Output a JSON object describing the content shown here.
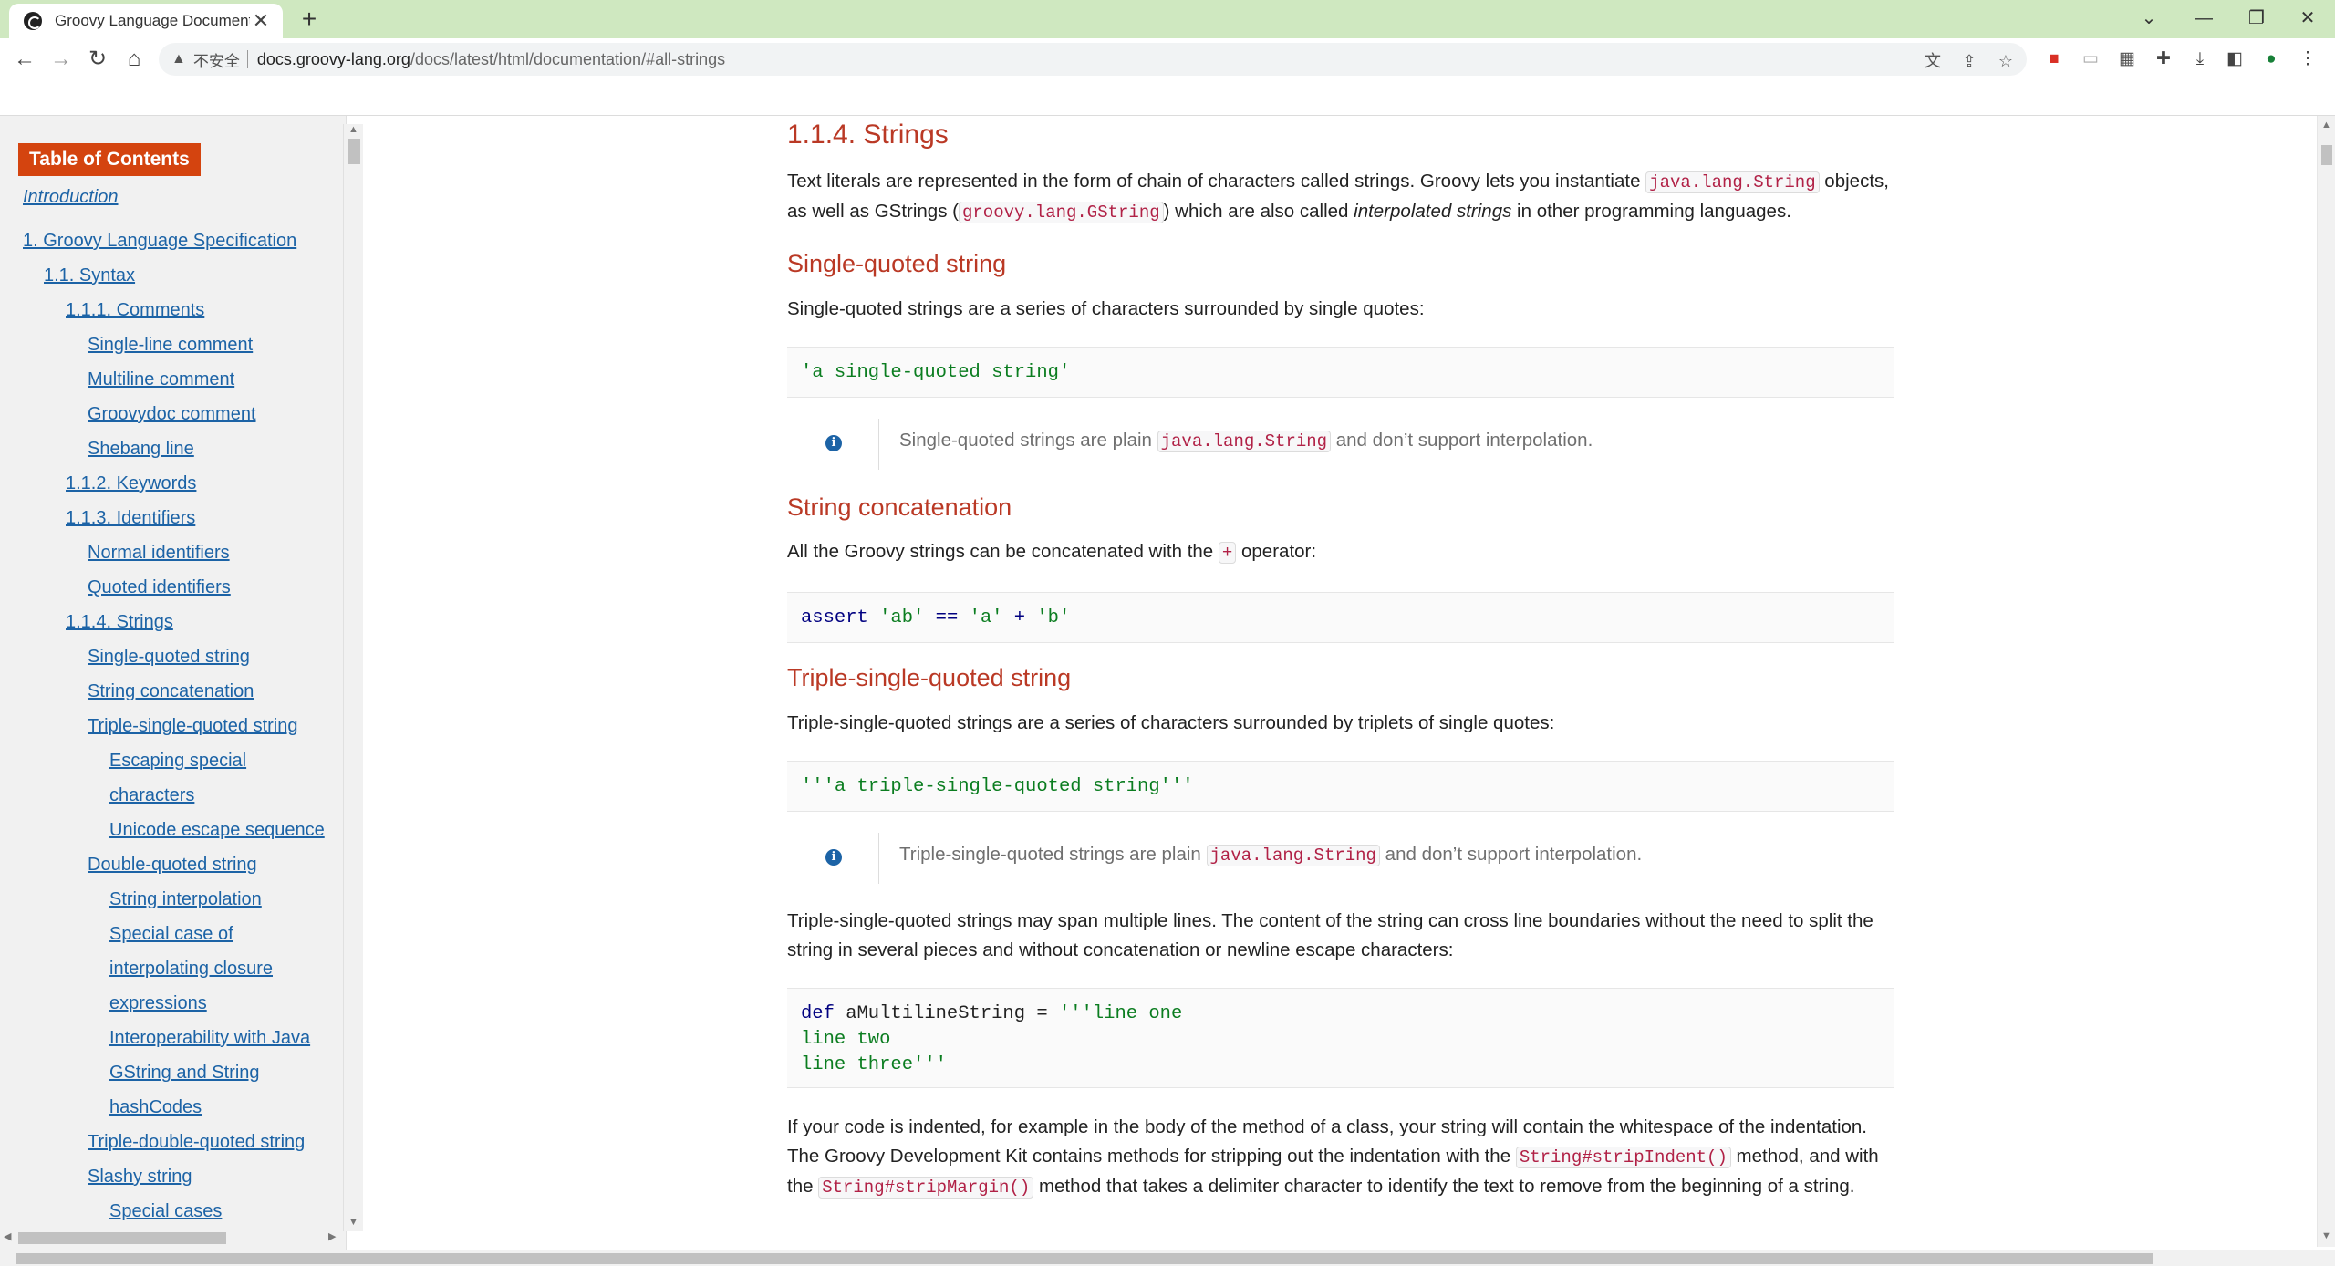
{
  "browser": {
    "tab_title": "Groovy Language Documentation",
    "new_tab": "+",
    "security_label": "不安全",
    "url_host": "docs.groovy-lang.org",
    "url_path": "/docs/latest/html/documentation/#all-strings",
    "window_controls": {
      "minimize": "—",
      "restore": "❐",
      "close": "✕",
      "tablist": "⌄"
    },
    "nav": {
      "back": "←",
      "forward": "→",
      "reload": "↻",
      "home": "⌂"
    }
  },
  "toc": {
    "title": "Table of Contents",
    "items": [
      {
        "label": "Introduction",
        "italic": true
      },
      {
        "label": "1. Groovy Language Specification"
      },
      {
        "label": "1.1. Syntax"
      },
      {
        "label": "1.1.1. Comments"
      },
      {
        "label": "Single-line comment"
      },
      {
        "label": "Multiline comment"
      },
      {
        "label": "Groovydoc comment"
      },
      {
        "label": "Shebang line"
      },
      {
        "label": "1.1.2. Keywords"
      },
      {
        "label": "1.1.3. Identifiers"
      },
      {
        "label": "Normal identifiers"
      },
      {
        "label": "Quoted identifiers"
      },
      {
        "label": "1.1.4. Strings"
      },
      {
        "label": "Single-quoted string"
      },
      {
        "label": "String concatenation"
      },
      {
        "label": "Triple-single-quoted string"
      },
      {
        "label": "Escaping special"
      },
      {
        "label": "characters"
      },
      {
        "label": "Unicode escape sequence"
      },
      {
        "label": "Double-quoted string"
      },
      {
        "label": "String interpolation"
      },
      {
        "label": "Special case of"
      },
      {
        "label": "interpolating closure"
      },
      {
        "label": "expressions"
      },
      {
        "label": "Interoperability with Java"
      },
      {
        "label": "GString and String"
      },
      {
        "label": "hashCodes"
      },
      {
        "label": "Triple-double-quoted string"
      },
      {
        "label": "Slashy string"
      },
      {
        "label": "Special cases"
      }
    ]
  },
  "content": {
    "section_title": "1.1.4. Strings",
    "intro": {
      "t1": "Text literals are represented in the form of chain of characters called strings. Groovy lets you instantiate ",
      "c1": "java.lang.String",
      "t2": " objects, as well as GStrings (",
      "c2": "groovy.lang.GString",
      "t3": ") which are also called ",
      "em": "interpolated strings",
      "t4": " in other programming languages."
    },
    "single": {
      "title": "Single-quoted string",
      "desc": "Single-quoted strings are a series of characters surrounded by single quotes:",
      "code": "'a single-quoted string'",
      "note_t1": "Single-quoted strings are plain ",
      "note_code": "java.lang.String",
      "note_t2": " and don’t support interpolation."
    },
    "concat": {
      "title": "String concatenation",
      "desc_t1": "All the Groovy strings can be concatenated with the ",
      "desc_code": "+",
      "desc_t2": " operator:",
      "code_kw": "assert",
      "code_a": "'ab'",
      "code_eq": " == ",
      "code_b": "'a'",
      "code_plus": " + ",
      "code_c": "'b'"
    },
    "triple": {
      "title": "Triple-single-quoted string",
      "desc": "Triple-single-quoted strings are a series of characters surrounded by triplets of single quotes:",
      "code": "'''a triple-single-quoted string'''",
      "note_t1": "Triple-single-quoted strings are plain ",
      "note_code": "java.lang.String",
      "note_t2": " and don’t support interpolation.",
      "multiline_desc": "Triple-single-quoted strings may span multiple lines. The content of the string can cross line boundaries without the need to split the string in several pieces and without concatenation or newline escape characters:",
      "ml_kw": "def",
      "ml_name": " aMultilineString = ",
      "ml_line1": "'''line one",
      "ml_line2": "line two",
      "ml_line3": "line three'''",
      "indent_t1": "If your code is indented, for example in the body of the method of a class, your string will contain the whitespace of the indentation. The Groovy Development Kit contains methods for stripping out the indentation with the ",
      "indent_c1": "String#stripIndent()",
      "indent_t2": " method, and with the ",
      "indent_c2": "String#stripMargin()",
      "indent_t3": " method that takes a delimiter character to identify the text to remove from the beginning of a string."
    }
  }
}
